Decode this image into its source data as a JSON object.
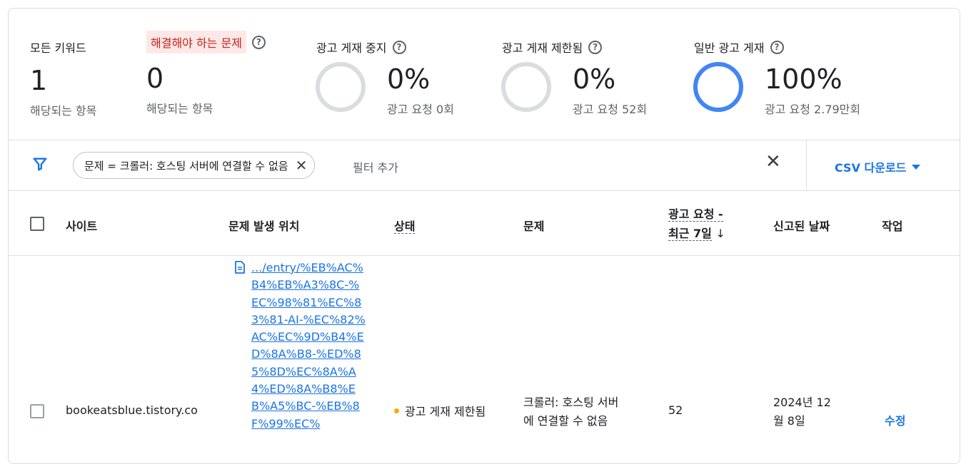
{
  "summary": {
    "all_keywords": {
      "label": "모든 키워드",
      "value": "1",
      "sub": "해당되는 항목"
    },
    "issues": {
      "label": "해결해야 하는 문제",
      "value": "0",
      "sub": "해당되는 항목"
    },
    "ads_stopped": {
      "label": "광고 게재 중지",
      "value": "0%",
      "sub": "광고 요청 0회",
      "fraction": 0
    },
    "ads_limited": {
      "label": "광고 게재 제한됨",
      "value": "0%",
      "sub": "광고 요청 52회",
      "fraction": 0
    },
    "ads_normal": {
      "label": "일반 광고 게재",
      "value": "100%",
      "sub": "광고 요청 2.79만회",
      "fraction": 1
    }
  },
  "filter": {
    "chip_label": "문제 = 크롤러: 호스팅 서버에 연결할 수 없음",
    "add_filter": "필터 추가",
    "csv_label": "CSV 다운로드"
  },
  "table": {
    "headers": {
      "site": "사이트",
      "location": "문제 발생 위치",
      "status": "상태",
      "issue": "문제",
      "requests_line1": "광고 요청 -",
      "requests_line2": "최근 7일",
      "reported": "신고된 날짜",
      "action": "작업"
    },
    "rows": [
      {
        "site": "bookeatsblue.tistory.co",
        "location": ".../entry/%EB%AC%B4%EB%A3%8C-%EC%98%81%EC%83%81-AI-%EC%82%AC%EC%9D%B4%ED%8A%B8-%ED%85%8D%EC%8A%A4%ED%8A%B8%EB%A5%BC-%EB%8F%99%EC%",
        "status": "광고 게재 제한됨",
        "issue_line1": "크롤러: 호스팅 서버",
        "issue_line2": "에 연결할 수 없음",
        "requests": "52",
        "reported_line1": "2024년 12",
        "reported_line2": "월 8일",
        "action": "수정"
      }
    ]
  },
  "colors": {
    "accent": "#1a73e8",
    "ring_empty": "#dadce0",
    "status_limited": "#f9ab00",
    "issue_bg": "#fce8e6",
    "issue_text": "#c5221f"
  },
  "icons": {
    "filter": "filter-icon",
    "help": "help-icon",
    "close": "close-icon",
    "doc": "document-icon",
    "sort": "arrow-down-icon"
  }
}
